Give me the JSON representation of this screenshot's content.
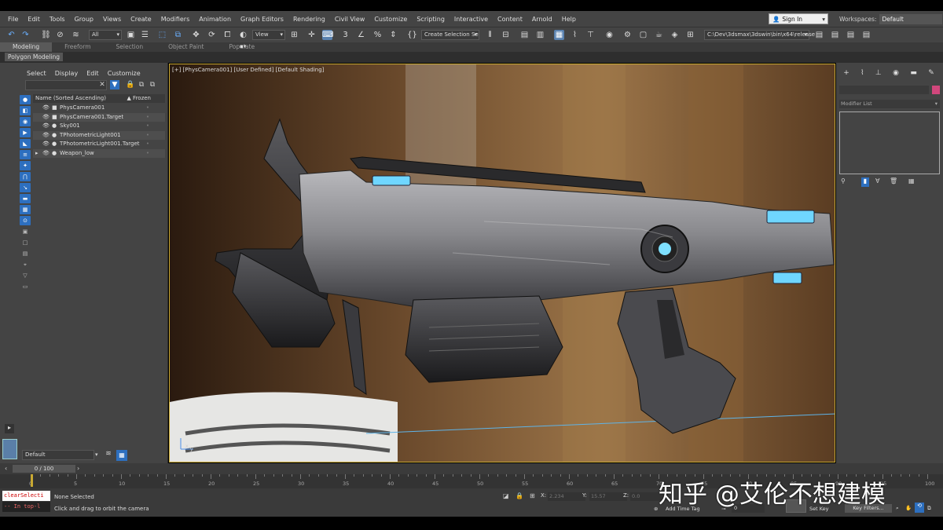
{
  "menus": [
    "File",
    "Edit",
    "Tools",
    "Group",
    "Views",
    "Create",
    "Modifiers",
    "Animation",
    "Graph Editors",
    "Rendering",
    "Civil View",
    "Customize",
    "Scripting",
    "Interactive",
    "Content",
    "Arnold",
    "Help"
  ],
  "account": {
    "sign_in": "Sign In",
    "workspaces_label": "Workspaces:",
    "workspace_value": "Default"
  },
  "toolbar": {
    "selection_filter": "All",
    "ref_coord": "View",
    "named_selection": "Create Selection Se",
    "project_path": "C:\\Dev\\3dsmax\\3dswin\\bin\\x64\\release"
  },
  "ribbon": {
    "tabs": [
      "Modeling",
      "Freeform",
      "Selection",
      "Object Paint",
      "Populate"
    ],
    "active_tab": "Modeling",
    "panel": "Polygon Modeling"
  },
  "scene_explorer": {
    "menu": [
      "Select",
      "Display",
      "Edit",
      "Customize"
    ],
    "header_name": "Name (Sorted Ascending)",
    "header_frozen": "▲ Frozen",
    "items": [
      "PhysCamera001",
      "PhysCamera001.Target",
      "Sky001",
      "TPhotometricLight001",
      "TPhotometricLight001.Target",
      "Weapon_low"
    ],
    "layer": "Default"
  },
  "viewport": {
    "label": "[+] [PhysCamera001] [User Defined] [Default Shading]"
  },
  "command_panel": {
    "modifier_list": "Modifier List"
  },
  "timeline": {
    "frame_readout": "0 / 100",
    "ticks": [
      "0",
      "5",
      "10",
      "15",
      "20",
      "25",
      "30",
      "35",
      "40",
      "45",
      "50",
      "55",
      "60",
      "65",
      "70",
      "75",
      "80",
      "85",
      "90",
      "95",
      "100"
    ]
  },
  "status": {
    "script_line1": "clearSelecti",
    "script_line2": "-- In top-l",
    "selected": "None Selected",
    "hint": "Click and drag to orbit the camera",
    "x_label": "X:",
    "x_value": "2.234",
    "y_label": "Y:",
    "y_value": "15.57",
    "z_label": "Z:",
    "z_value": "0.0",
    "add_time_tag": "Add Time Tag",
    "set_key": "Set Key",
    "key_filters": "Key Filters...",
    "frame_value": "0"
  },
  "watermark": "知乎 @艾伦不想建模",
  "colors": {
    "selection_accent": "#2d6fbf",
    "viewport_border": "#c8a832",
    "object_color": "#d1477c",
    "glow": "#6fd6ff"
  }
}
